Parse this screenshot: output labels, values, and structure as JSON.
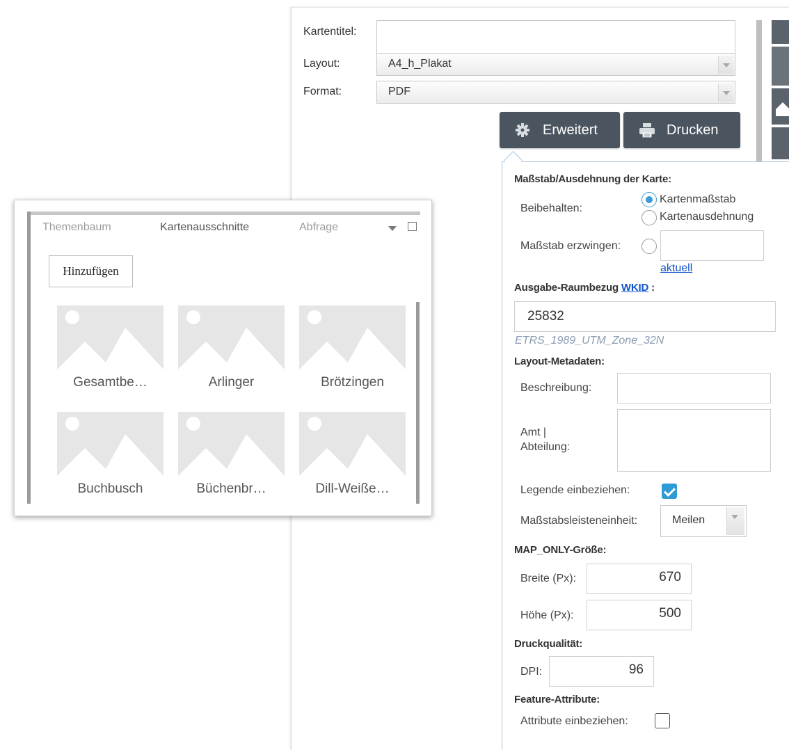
{
  "print_panel": {
    "title_label": "Kartentitel:",
    "title_value": "",
    "layout_label": "Layout:",
    "layout_value": "A4_h_Plakat",
    "format_label": "Format:",
    "format_value": "PDF",
    "advanced_button": "Erweitert",
    "print_button": "Drucken"
  },
  "advanced": {
    "scale_extent_title": "Maßstab/Ausdehnung der Karte:",
    "preserve_label": "Beibehalten:",
    "preserve_options": [
      "Kartenmaßstab",
      "Kartenausdehnung"
    ],
    "preserve_selected": "Kartenmaßstab",
    "force_scale_label": "Maßstab erzwingen:",
    "force_scale_value": "",
    "current_link": "aktuell",
    "output_sr_title": "Ausgabe-Raumbezug",
    "wkid_link": "WKID",
    "output_sr_colon": ":",
    "wkid_value": "25832",
    "wkid_hint": "ETRS_1989_UTM_Zone_32N",
    "layout_meta_title": "Layout-Metadaten:",
    "description_label": "Beschreibung:",
    "description_value": "",
    "office_label_line1": "Amt |",
    "office_label_line2": "Abteilung:",
    "office_value": "",
    "legend_label": "Legende einbeziehen:",
    "legend_checked": true,
    "scalebar_label": "Maßstabsleisteneinheit:",
    "scalebar_value": "Meilen",
    "map_only_title": "MAP_ONLY-Größe:",
    "width_label": "Breite (Px):",
    "width_value": "670",
    "height_label": "Höhe (Px):",
    "height_value": "500",
    "quality_title": "Druckqualität:",
    "dpi_label": "DPI:",
    "dpi_value": "96",
    "feature_attr_title": "Feature-Attribute:",
    "include_attr_label": "Attribute einbeziehen:",
    "include_attr_checked": false
  },
  "widget": {
    "tabs": [
      "Themenbaum",
      "Kartenausschnitte",
      "Abfrage"
    ],
    "active_tab": "Kartenausschnitte",
    "add_button": "Hinzufügen",
    "bookmarks": [
      "Gesamtbe…",
      "Arlinger",
      "Brötzingen",
      "Buchbusch",
      "Büchenbr…",
      "Dill-Weiße…"
    ]
  },
  "colors": {
    "button_dark": "#4b5560",
    "accent_blue": "#2f9bd6",
    "placeholder_gray": "#e6e6e6"
  }
}
